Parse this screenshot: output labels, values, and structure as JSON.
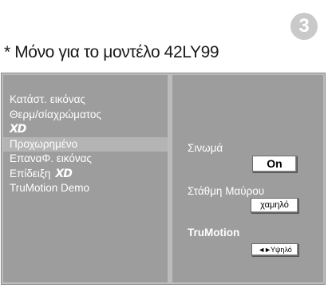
{
  "step_number": "3",
  "note": "* Μόνο για το μοντέλο 42LY99",
  "menu": {
    "items": [
      {
        "label": "Κατάστ. εικόνας"
      },
      {
        "label": "Θερμ/σίαχρώματος"
      },
      {
        "label": "XD"
      },
      {
        "label": "Προχωρημένο"
      },
      {
        "label": "ΕπαναΦ. εικόνας"
      },
      {
        "label": "Επίδειξη"
      },
      {
        "label": "TruMotion Demo"
      }
    ],
    "demo_logo": "XD"
  },
  "settings": {
    "cinema_label": "Σινωμά",
    "cinema_value": "On",
    "black_level_label": "Στάθμη Μαύρου",
    "black_level_value": "χαμηλό",
    "trumotion_label": "TruMotion",
    "trumotion_arrows": "◄►",
    "trumotion_value": "Υψηλό"
  }
}
